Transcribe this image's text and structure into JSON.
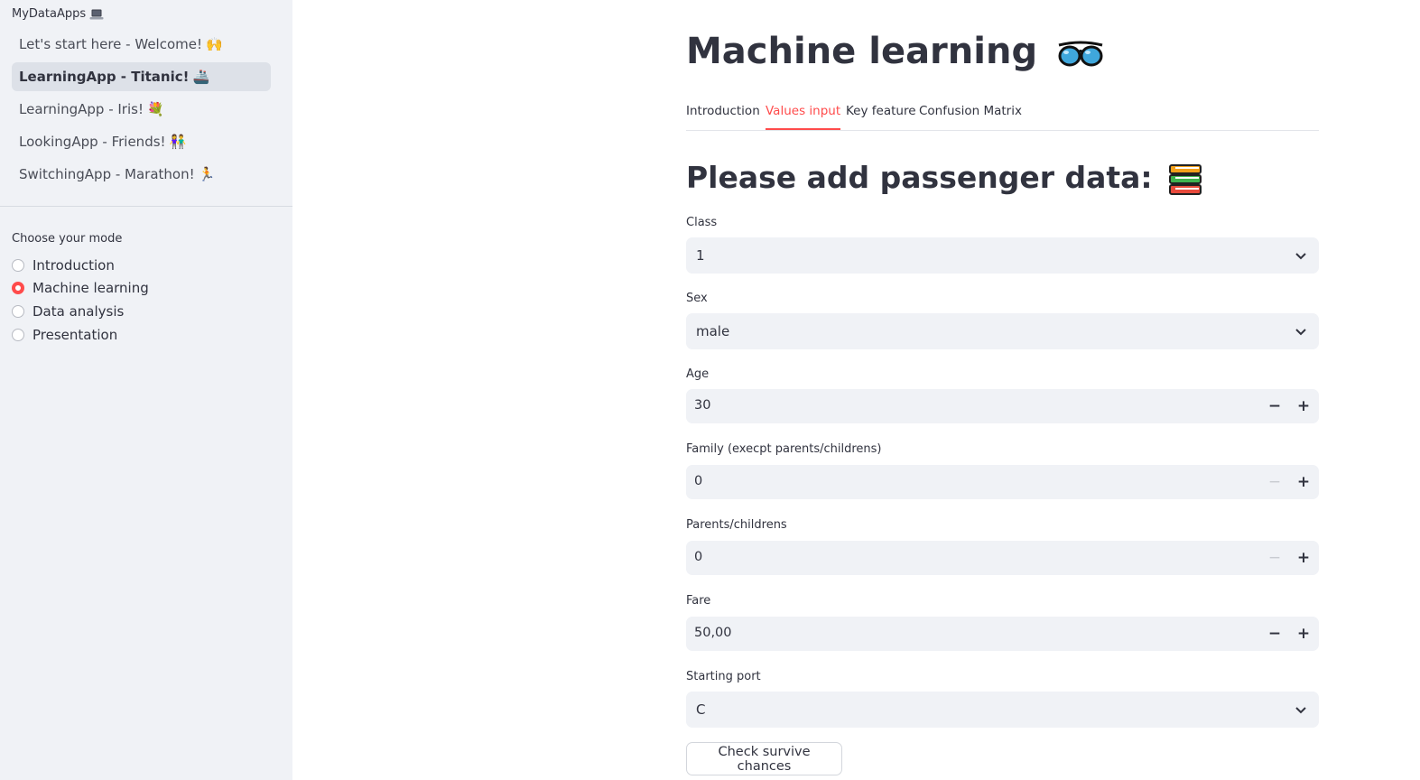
{
  "sidebar": {
    "app_header": "MyDataApps",
    "app_header_icon": "laptop-icon",
    "nav_items": [
      {
        "label": "Let's start here - Welcome!",
        "icon": "🙌",
        "active": false
      },
      {
        "label": "LearningApp - Titanic!",
        "icon": "🚢",
        "active": true
      },
      {
        "label": "LearningApp - Iris!",
        "icon": "💐",
        "active": false
      },
      {
        "label": "LookingApp - Friends!",
        "icon": "👫",
        "active": false
      },
      {
        "label": "SwitchingApp - Marathon!",
        "icon": "🏃",
        "active": false
      }
    ],
    "mode_label": "Choose your mode",
    "modes": [
      {
        "label": "Introduction",
        "selected": false
      },
      {
        "label": "Machine learning",
        "selected": true
      },
      {
        "label": "Data analysis",
        "selected": false
      },
      {
        "label": "Presentation",
        "selected": false
      }
    ]
  },
  "main": {
    "title": "Machine learning",
    "title_icon": "sunglasses-icon",
    "tabs": [
      {
        "label": "Introduction",
        "active": false
      },
      {
        "label": "Values input",
        "active": true
      },
      {
        "label": "Key feature",
        "active": false
      },
      {
        "label": "Confusion Matrix",
        "active": false
      }
    ],
    "subheader": "Please add passenger data:",
    "subheader_icon": "books-icon",
    "fields": {
      "class": {
        "label": "Class",
        "value": "1"
      },
      "sex": {
        "label": "Sex",
        "value": "male"
      },
      "age": {
        "label": "Age",
        "value": "30"
      },
      "family": {
        "label": "Family (execpt parents/childrens)",
        "value": "0"
      },
      "parents": {
        "label": "Parents/childrens",
        "value": "0"
      },
      "fare": {
        "label": "Fare",
        "value": "50,00"
      },
      "port": {
        "label": "Starting port",
        "value": "C"
      }
    },
    "stepper": {
      "minus": "−",
      "plus": "+"
    },
    "submit_label": "Check survive chances"
  },
  "colors": {
    "accent": "#ff4b4b",
    "sidebar_bg": "#f0f2f6",
    "input_bg": "#f0f2f6",
    "text": "#31333f"
  }
}
